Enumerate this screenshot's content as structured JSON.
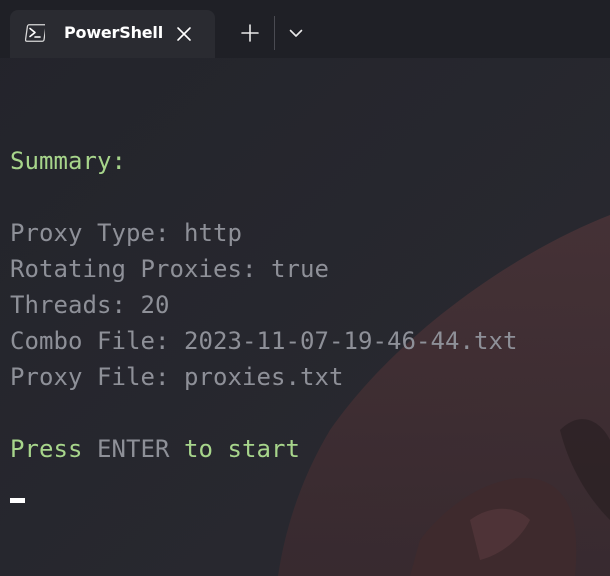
{
  "tab": {
    "title": "PowerShell",
    "icon": "powershell-icon"
  },
  "toolbar": {
    "new_tab_icon": "plus-icon",
    "dropdown_icon": "chevron-down-icon"
  },
  "terminal": {
    "summary_heading": "Summary:",
    "lines": [
      "Proxy Type: http",
      "Rotating Proxies: true",
      "Threads: 20",
      "Combo File: 2023-11-07-19-46-44.txt",
      "Proxy File: proxies.txt"
    ],
    "prompt": {
      "part1": "Press",
      "part2": " ENTER ",
      "part3": "to start"
    }
  },
  "colors": {
    "background": "#25262d",
    "green_text": "#a7d58b",
    "grey_text": "#8e9098",
    "tab_active": "#2a2b31",
    "tabbar": "#1f2026"
  }
}
